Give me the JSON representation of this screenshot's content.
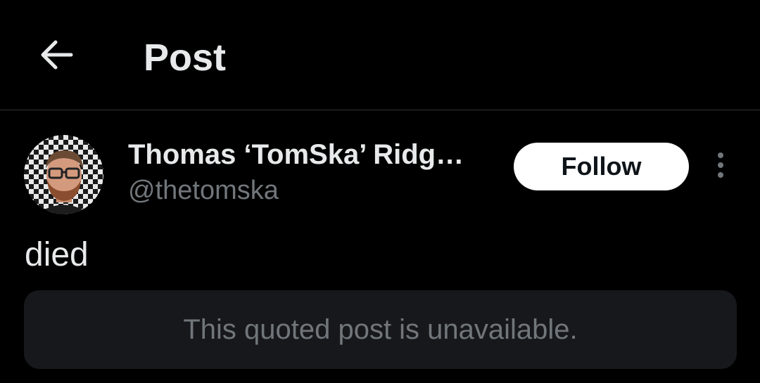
{
  "header": {
    "title": "Post",
    "back_icon": "arrow-left-icon"
  },
  "post": {
    "author": {
      "display_name": "Thomas ‘TomSka’ Ridg…",
      "handle": "@thetomska",
      "avatar": "avatar-photo"
    },
    "follow_label": "Follow",
    "more_icon": "more-vertical-icon",
    "text": "died",
    "quoted_post": {
      "message": "This quoted post is unavailable."
    }
  },
  "colors": {
    "background": "#000000",
    "primary_text": "#e7e9ea",
    "secondary_text": "#71767b",
    "divider": "#2f3336",
    "quote_background": "#16181c",
    "follow_button_bg": "#ffffff",
    "follow_button_text": "#0f1419"
  }
}
